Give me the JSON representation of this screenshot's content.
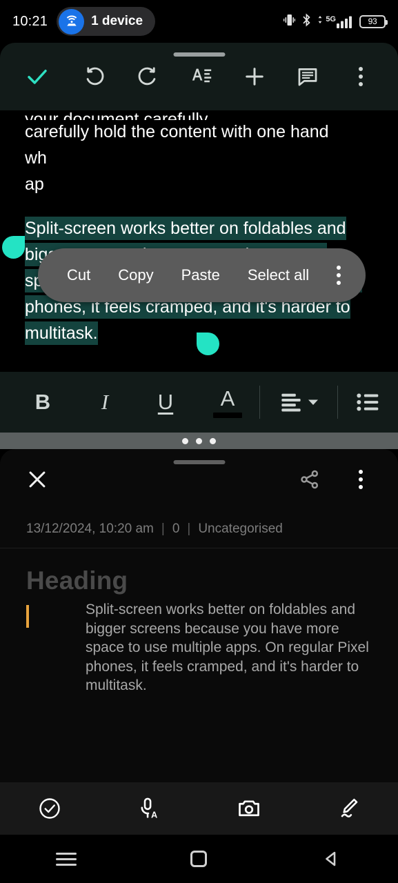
{
  "status_bar": {
    "clock": "10:21",
    "device_pill_label": "1 device",
    "hotspot_icon": "hotspot-icon",
    "vibrate_icon": "vibrate-icon",
    "bluetooth_icon": "bluetooth-icon",
    "network_label": "5G",
    "signal_icon": "signal-bars-icon",
    "battery_level": "93"
  },
  "editor": {
    "toolbar": {
      "done_label": "done-check-icon",
      "undo_label": "undo-icon",
      "redo_label": "redo-icon",
      "text_format_label": "text-format-icon",
      "add_label": "add-icon",
      "comment_label": "comment-icon",
      "overflow_label": "overflow-menu-icon"
    },
    "document": {
      "clipped_line_top": "your document carefully",
      "paragraph_above": "carefully hold the content with one hand",
      "hidden_line_2": "wh",
      "hidden_line_3": "ap",
      "selected_text": "Split-screen works better on foldables and bigger screens because you have more space to use multiple apps. On regular Pixel phones, it feels cramped, and it's harder to multitask.",
      "highlight_color": "#14433e",
      "handle_color": "#24e3c4"
    },
    "context_menu": {
      "items": [
        {
          "label": "Cut"
        },
        {
          "label": "Copy"
        },
        {
          "label": "Paste"
        },
        {
          "label": "Select all"
        }
      ],
      "overflow": "context-overflow-icon"
    },
    "format_bar": {
      "bold": "B",
      "italic": "I",
      "underline": "U",
      "text_color": "A",
      "align": "align-left-icon",
      "align_dropdown": "chevron-down-icon",
      "bullet_list": "bulleted-list-icon"
    }
  },
  "split_divider": {
    "handle": "split-screen-handle"
  },
  "notes_app": {
    "header": {
      "close": "close-icon",
      "share": "share-icon",
      "overflow": "overflow-menu-icon"
    },
    "meta": {
      "timestamp": "13/12/2024, 10:20 am",
      "separator": "|",
      "word_count": "0",
      "category": "Uncategorised"
    },
    "note": {
      "heading_placeholder": "Heading",
      "body": "Split-screen works better on foldables and bigger screens because you have more space to use multiple apps. On regular Pixel phones, it feels cramped, and it's harder to multitask.",
      "cursor_color": "#e8a33d"
    },
    "bottom_toolbar": {
      "checklist": "check-circle-icon",
      "voice": "voice-typing-icon",
      "camera": "camera-icon",
      "draw": "draw-pen-icon"
    }
  },
  "nav_bar": {
    "recents": "recents-icon",
    "home": "home-icon",
    "back": "back-icon"
  },
  "colors": {
    "accent_teal": "#24e3c4",
    "toolbar_bg": "#121b19",
    "cursor_amber": "#e8a33d"
  }
}
